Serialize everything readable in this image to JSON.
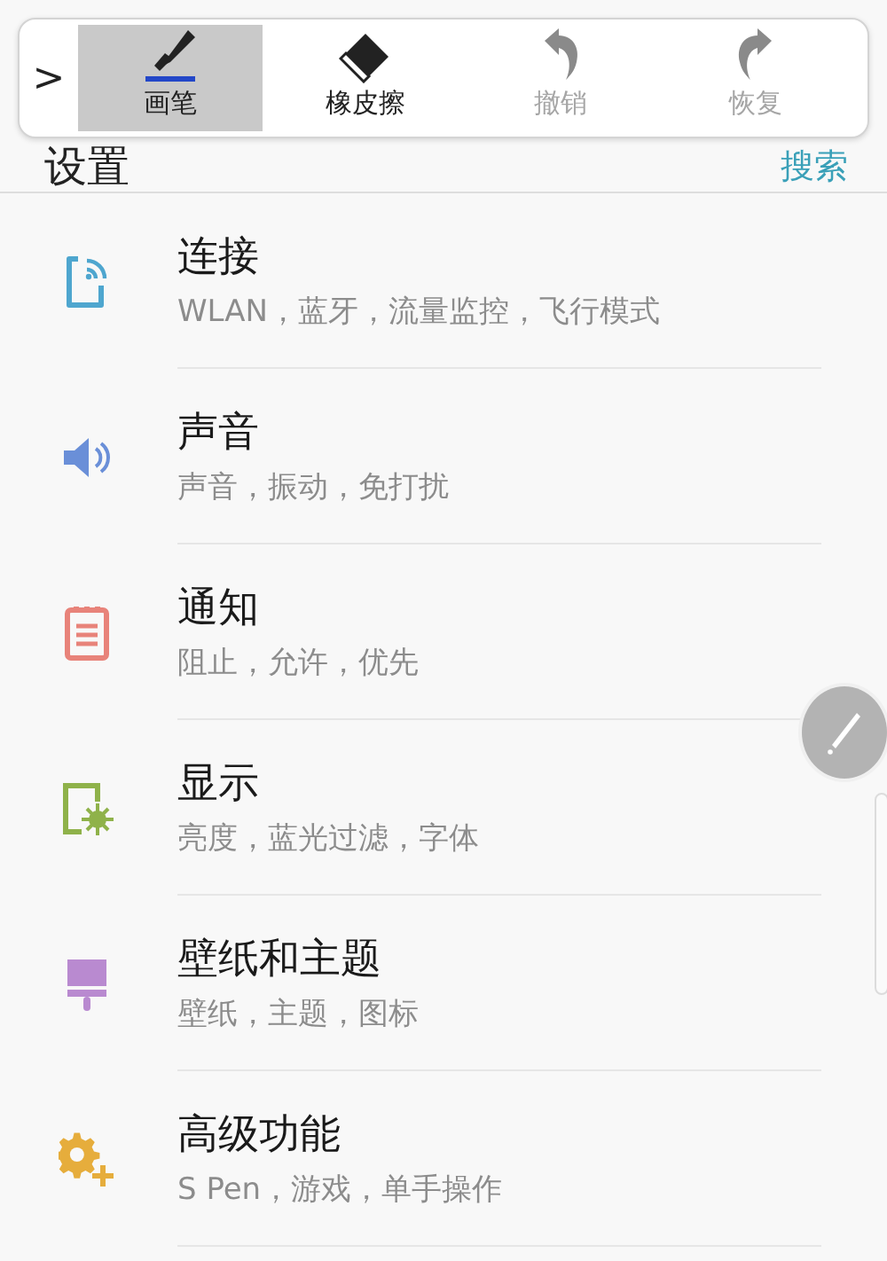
{
  "header": {
    "title": "设置",
    "search": "搜索"
  },
  "pen_toolbar": {
    "expand": ">",
    "tools": [
      {
        "kind": "pen",
        "label": "画笔",
        "selected": true,
        "disabled": false
      },
      {
        "kind": "eraser",
        "label": "橡皮擦",
        "selected": false,
        "disabled": false
      },
      {
        "kind": "undo",
        "label": "撤销",
        "selected": false,
        "disabled": true
      },
      {
        "kind": "redo",
        "label": "恢复",
        "selected": false,
        "disabled": true
      }
    ]
  },
  "settings": [
    {
      "kind": "connections",
      "title": "连接",
      "subtitle": "WLAN，蓝牙，流量监控，飞行模式",
      "color": "#4ea6cf"
    },
    {
      "kind": "sound",
      "title": "声音",
      "subtitle": "声音，振动，免打扰",
      "color": "#6a8fd8"
    },
    {
      "kind": "notifications",
      "title": "通知",
      "subtitle": "阻止，允许，优先",
      "color": "#e8837a"
    },
    {
      "kind": "display",
      "title": "显示",
      "subtitle": "亮度，蓝光过滤，字体",
      "color": "#8fb24a"
    },
    {
      "kind": "wallpaper",
      "title": "壁纸和主题",
      "subtitle": "壁纸，主题，图标",
      "color": "#b98ad0"
    },
    {
      "kind": "advanced",
      "title": "高级功能",
      "subtitle": "S Pen，游戏，单手操作",
      "color": "#e6ad3c"
    }
  ]
}
